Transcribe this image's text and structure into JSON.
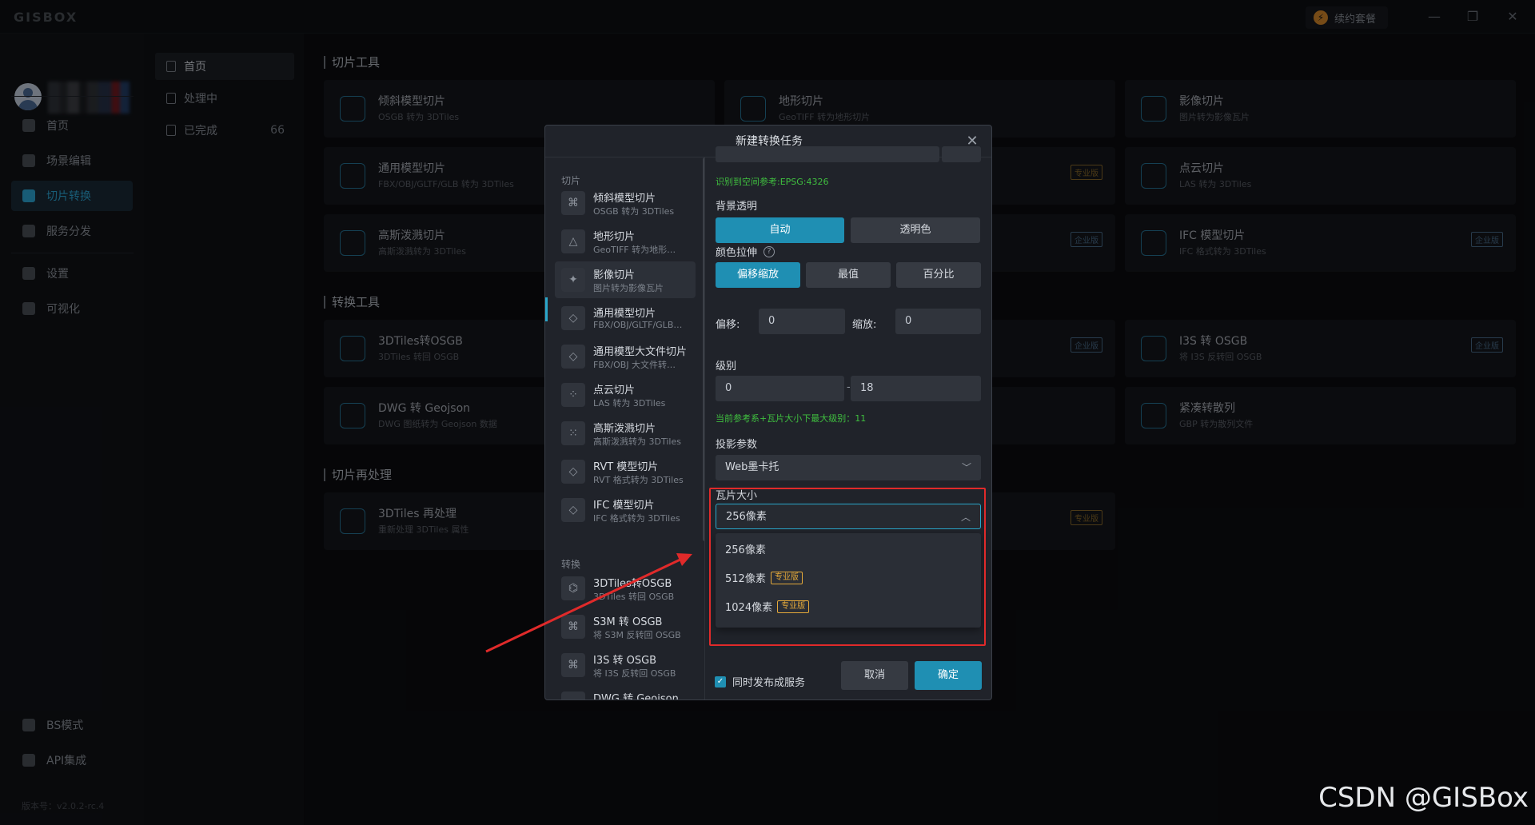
{
  "app": {
    "logo": "GISBOX",
    "renew": "续约套餐"
  },
  "window": {
    "minimize": "—",
    "restore": "❐",
    "close": "✕"
  },
  "sidebar": {
    "items": [
      {
        "label": "首页",
        "icon": "home-icon"
      },
      {
        "label": "场景编辑",
        "icon": "cube-icon"
      },
      {
        "label": "切片转换",
        "icon": "swap-icon"
      },
      {
        "label": "服务分发",
        "icon": "upload-icon"
      },
      {
        "label": "设置",
        "icon": "gear-icon"
      },
      {
        "label": "可视化",
        "icon": "chart-icon"
      }
    ],
    "bottom": [
      {
        "label": "BS模式",
        "icon": "code-icon"
      },
      {
        "label": "API集成",
        "icon": "api-icon"
      }
    ],
    "version": "版本号：v2.0.2-rc.4"
  },
  "subnav": {
    "items": [
      {
        "label": "首页"
      },
      {
        "label": "处理中"
      },
      {
        "label": "已完成",
        "count": "66"
      }
    ]
  },
  "main": {
    "sections": [
      "切片工具",
      "转换工具",
      "切片再处理"
    ],
    "cards": [
      {
        "title": "倾斜模型切片",
        "sub": "OSGB 转为 3DTiles"
      },
      {
        "title": "地形切片",
        "sub": "GeoTIFF 转为地形切片"
      },
      {
        "title": "影像切片",
        "sub": "图片转为影像瓦片"
      },
      {
        "title": "通用模型切片",
        "sub": "FBX/OBJ/GLTF/GLB 转为 3DTiles"
      },
      {
        "title": "点云切片",
        "sub": "LAS 转为 3DTiles"
      },
      {
        "title": "高斯泼溅切片",
        "sub": "高斯泼溅转为 3DTiles"
      },
      {
        "title": "IFC 模型切片",
        "sub": "IFC 格式转为 3DTiles"
      },
      {
        "title": "3DTiles转OSGB",
        "sub": "3DTiles 转回 OSGB"
      },
      {
        "title": "I3S 转 OSGB",
        "sub": "将 I3S 反转回 OSGB"
      },
      {
        "title": "DWG 转 Geojson",
        "sub": "DWG 图纸转为 Geojson 数据"
      },
      {
        "title": "紧凑转散列",
        "sub": "GBP 转为散列文件"
      },
      {
        "title": "3DTiles 再处理",
        "sub": "重新处理 3DTiles 属性"
      }
    ],
    "badges": {
      "pro": "专业版",
      "ent": "企业版"
    }
  },
  "dialog": {
    "title": "新建转换任务",
    "groups": {
      "slice": "切片",
      "convert": "转换"
    },
    "tools": [
      {
        "title": "倾斜模型切片",
        "sub": "OSGB 转为 3DTiles"
      },
      {
        "title": "地形切片",
        "sub": "GeoTIFF 转为地形…"
      },
      {
        "title": "影像切片",
        "sub": "图片转为影像瓦片"
      },
      {
        "title": "通用模型切片",
        "sub": "FBX/OBJ/GLTF/GLB…"
      },
      {
        "title": "通用模型大文件切片",
        "sub": "FBX/OBJ 大文件转…"
      },
      {
        "title": "点云切片",
        "sub": "LAS 转为 3DTiles"
      },
      {
        "title": "高斯泼溅切片",
        "sub": "高斯泼溅转为 3DTiles"
      },
      {
        "title": "RVT 模型切片",
        "sub": "RVT 格式转为 3DTiles"
      },
      {
        "title": "IFC 模型切片",
        "sub": "IFC 格式转为 3DTiles"
      },
      {
        "title": "3DTiles转OSGB",
        "sub": "3DTiles 转回 OSGB"
      },
      {
        "title": "S3M 转 OSGB",
        "sub": "将 S3M 反转回 OSGB"
      },
      {
        "title": "I3S 转 OSGB",
        "sub": "将 I3S 反转回 OSGB"
      },
      {
        "title": "DWG 转 Geojson",
        "sub": ""
      }
    ],
    "form": {
      "crs_detected": "识别到空间参考:EPSG:4326",
      "bg_label": "背景透明",
      "bg_auto": "自动",
      "bg_transparent": "透明色",
      "stretch_label": "颜色拉伸",
      "stretch_offset": "偏移缩放",
      "stretch_minmax": "最值",
      "stretch_percent": "百分比",
      "offset_label": "偏移:",
      "offset_value": "0",
      "scale_label": "缩放:",
      "scale_value": "0",
      "level_label": "级别",
      "level_min": "0",
      "level_sep": "-",
      "level_max": "18",
      "level_hint": "当前参考系+瓦片大小下最大级别：11",
      "proj_label": "投影参数",
      "proj_value": "Web墨卡托",
      "tile_label": "瓦片大小",
      "tile_value": "256像素",
      "options": [
        {
          "label": "256像素",
          "badge": ""
        },
        {
          "label": "512像素",
          "badge": "专业版"
        },
        {
          "label": "1024像素",
          "badge": "专业版"
        }
      ]
    },
    "footer": {
      "publish": "同时发布成服务",
      "cancel": "取消",
      "confirm": "确定"
    }
  },
  "watermark": "CSDN @GISBox",
  "colors": {
    "accent": "#1f8fb3",
    "highlight": "#e02a2a",
    "pro": "#e4a93a"
  }
}
